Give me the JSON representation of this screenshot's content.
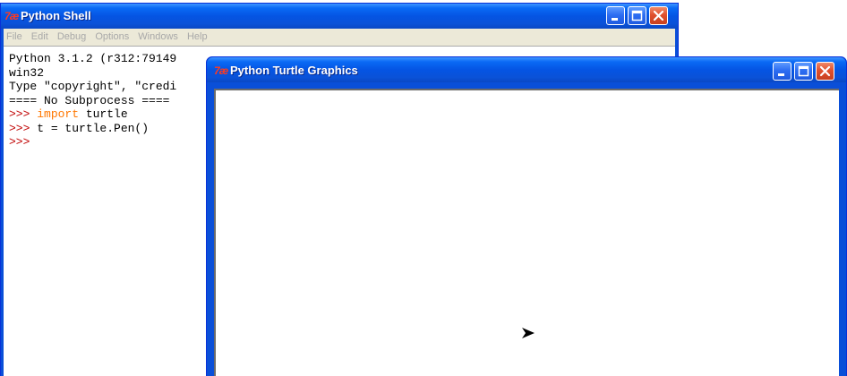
{
  "shell": {
    "title": "Python Shell",
    "icon_glyph": "7æ",
    "menu": [
      "File",
      "Edit",
      "Debug",
      "Options",
      "Windows",
      "Help"
    ],
    "lines": {
      "line1": "Python 3.1.2 (r312:79149",
      "line2": "win32",
      "line3": "Type \"copyright\", \"credi",
      "line4": "==== No Subprocess ====",
      "line5_prompt": ">>> ",
      "line5_kw": "import",
      "line5_rest": " turtle",
      "line6_prompt": ">>> ",
      "line6_rest": "t = turtle.Pen()",
      "line7_prompt": ">>>"
    }
  },
  "turtle_window": {
    "title": "Python Turtle Graphics",
    "icon_glyph": "7æ"
  },
  "colors": {
    "titlebar": "#0554e3",
    "prompt": "#c00000",
    "keyword": "#ff7700"
  }
}
